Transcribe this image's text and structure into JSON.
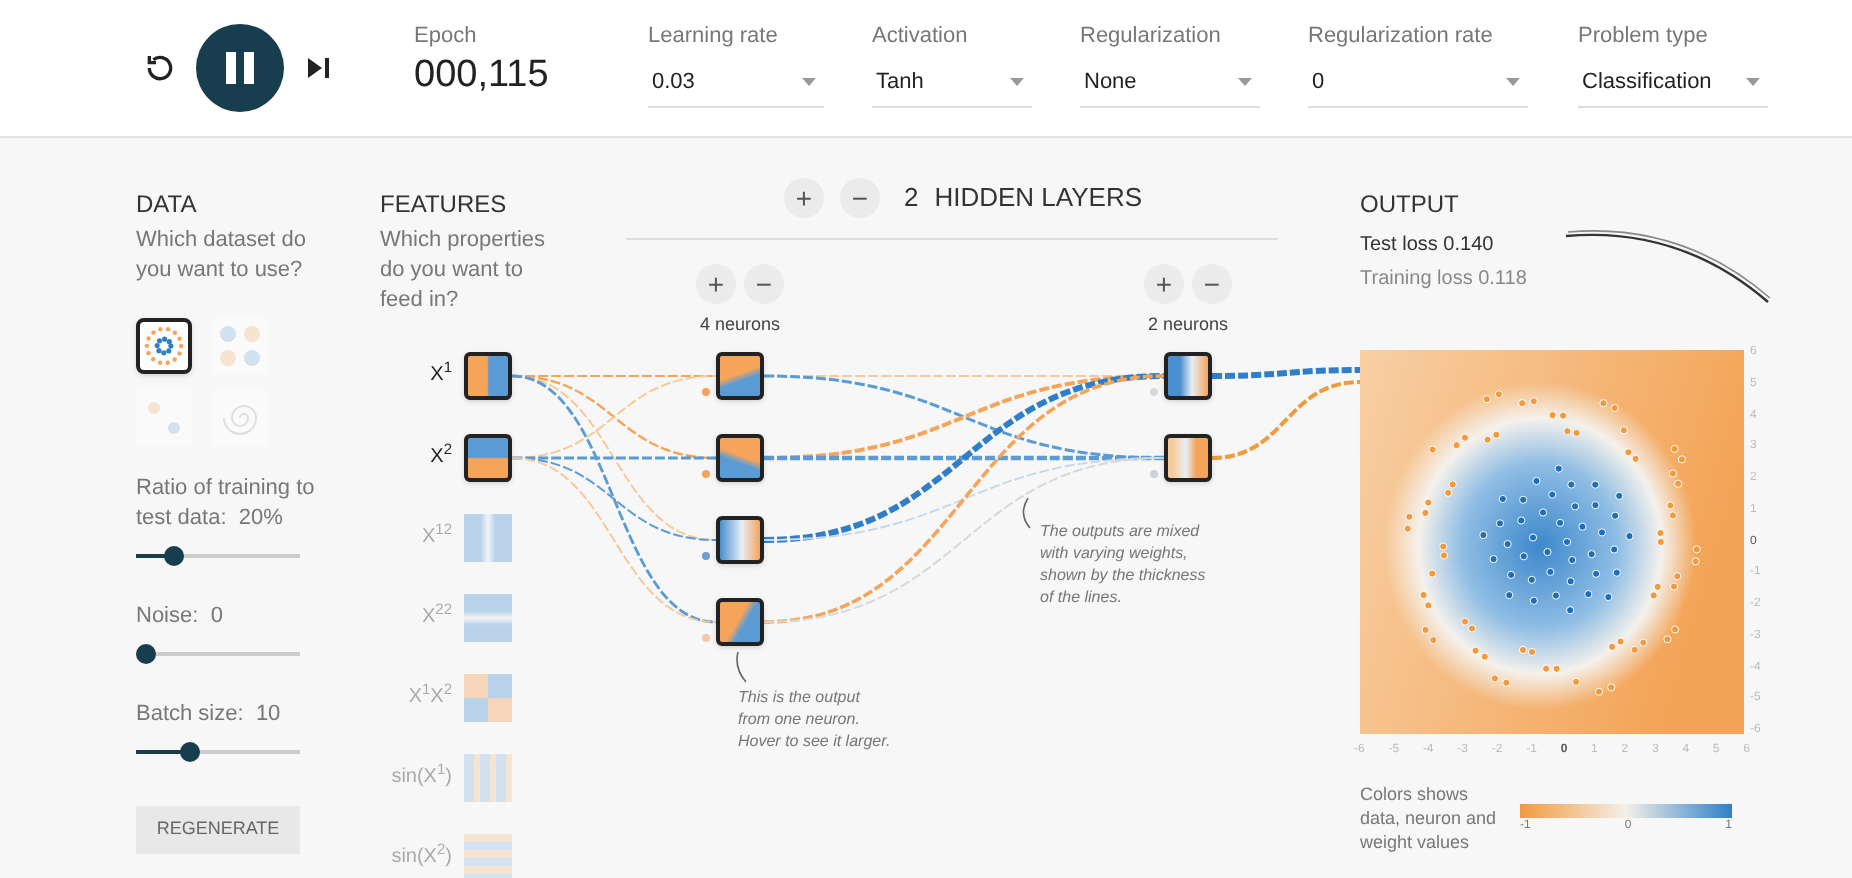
{
  "controls": {
    "epoch_label": "Epoch",
    "epoch": "000,115",
    "playing": true
  },
  "dropdowns": [
    {
      "label": "Learning rate",
      "value": "0.03"
    },
    {
      "label": "Activation",
      "value": "Tanh"
    },
    {
      "label": "Regularization",
      "value": "None"
    },
    {
      "label": "Regularization rate",
      "value": "0"
    },
    {
      "label": "Problem type",
      "value": "Classification"
    }
  ],
  "data": {
    "title": "DATA",
    "question": "Which dataset do you want to use?",
    "datasets": [
      {
        "kind": "circle",
        "selected": true
      },
      {
        "kind": "xor",
        "selected": false
      },
      {
        "kind": "gauss",
        "selected": false
      },
      {
        "kind": "spiral",
        "selected": false
      }
    ],
    "sliders": [
      {
        "label": "Ratio of training to test data:",
        "value": "20%",
        "level": 0.2
      },
      {
        "label": "Noise:",
        "value": "0",
        "level": 0
      },
      {
        "label": "Batch size:",
        "value": "10",
        "level": 0.3
      }
    ],
    "regenerate": "REGENERATE"
  },
  "features": {
    "title": "FEATURES",
    "question": "Which properties do you want to feed in?",
    "inputs": [
      {
        "label": "X$^{1}$",
        "active": true
      },
      {
        "label": "X$^{2}$",
        "active": true
      },
      {
        "label": "X$^{12}$",
        "active": false
      },
      {
        "label": "X$^{22}$",
        "active": false
      },
      {
        "label": "X$^{1}$X$^{2}$",
        "active": false
      },
      {
        "label": "sin(X$^{1}$)",
        "active": false
      },
      {
        "label": "sin(X$^{2}$)",
        "active": false
      }
    ]
  },
  "network": {
    "add": "+",
    "remove": "−",
    "layer_count": "2",
    "layers_label": "HIDDEN LAYERS",
    "layers": [
      {
        "add": "+",
        "remove": "−",
        "neurons_label": "4 neurons",
        "neurons": [
          {
            "color": "#f5a35c"
          },
          {
            "color": "#f5a35c"
          },
          {
            "color": "#6a9fd4"
          },
          {
            "color": "#f5c8a0"
          }
        ]
      },
      {
        "add": "+",
        "remove": "−",
        "neurons_label": "2 neurons",
        "neurons": [
          {
            "color": "#d9d9d9"
          },
          {
            "color": "#c9d2dc"
          }
        ]
      }
    ],
    "annotations": [
      "This is the output from one neuron. Hover to see it larger.",
      "The outputs are mixed with varying weights, shown by the thickness of the lines."
    ]
  },
  "output": {
    "title": "OUTPUT",
    "test_loss": "Test loss 0.140",
    "training_loss": "Training loss 0.118",
    "y_ticks": [
      {
        "label": "6",
        "major": false
      },
      {
        "label": "5",
        "major": false
      },
      {
        "label": "4",
        "major": false
      },
      {
        "label": "3",
        "major": false
      },
      {
        "label": "2",
        "major": false
      },
      {
        "label": "1",
        "major": false
      },
      {
        "label": "0",
        "major": true
      },
      {
        "label": "-1",
        "major": false
      },
      {
        "label": "-2",
        "major": false
      },
      {
        "label": "-3",
        "major": false
      },
      {
        "label": "-4",
        "major": false
      },
      {
        "label": "-5",
        "major": false
      },
      {
        "label": "-6",
        "major": false
      }
    ],
    "x_ticks": [
      {
        "label": "-6",
        "major": false
      },
      {
        "label": "-5",
        "major": false
      },
      {
        "label": "-4",
        "major": false
      },
      {
        "label": "-3",
        "major": false
      },
      {
        "label": "-2",
        "major": false
      },
      {
        "label": "-1",
        "major": false
      },
      {
        "label": "0",
        "major": true
      },
      {
        "label": "1",
        "major": false
      },
      {
        "label": "2",
        "major": false
      },
      {
        "label": "3",
        "major": false
      },
      {
        "label": "4",
        "major": false
      },
      {
        "label": "5",
        "major": false
      },
      {
        "label": "6",
        "major": false
      }
    ],
    "legend_text": "Colors shows data, neuron and weight values",
    "legend_ticks": [
      "-1",
      "0",
      "1"
    ]
  }
}
